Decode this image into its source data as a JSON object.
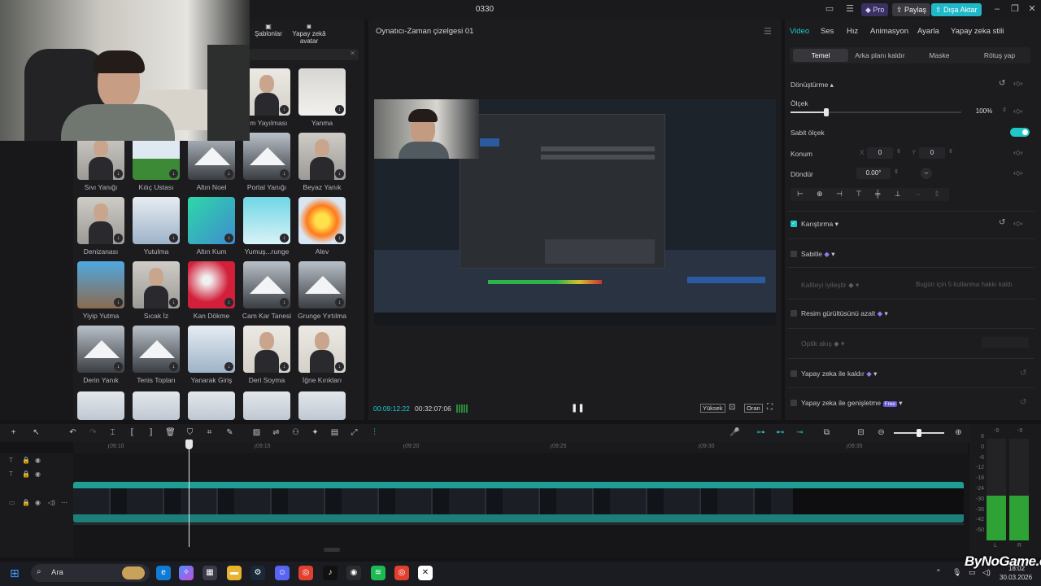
{
  "window": {
    "title": "0330",
    "pro_label": "Pro",
    "share_label": "Paylaş",
    "export_label": "Dışa Aktar"
  },
  "left_toolbar": {
    "templates_label": "Şablonlar",
    "ai_avatar_label": "Yapay zekâ avatar"
  },
  "effects": [
    {
      "label": "um Yayılması",
      "kind": "dark"
    },
    {
      "label": "Yanma",
      "kind": "light"
    },
    {
      "label": "Sıvı Yanığı",
      "kind": "face"
    },
    {
      "label": "Kılıç Ustası",
      "kind": "green"
    },
    {
      "label": "Altın Noel",
      "kind": "mountain"
    },
    {
      "label": "Portal Yanığı",
      "kind": "mountain"
    },
    {
      "label": "Beyaz Yanık",
      "kind": "face"
    },
    {
      "label": "Denizanası",
      "kind": "face"
    },
    {
      "label": "Yutulma",
      "kind": "sky"
    },
    {
      "label": "Altın Kum",
      "kind": "teal"
    },
    {
      "label": "Yumuş...runge",
      "kind": "cyan"
    },
    {
      "label": "Alev",
      "kind": "fire"
    },
    {
      "label": "Yiyip Yutma",
      "kind": "blue"
    },
    {
      "label": "Sıcak İz",
      "kind": "face"
    },
    {
      "label": "Kan Dökme",
      "kind": "red"
    },
    {
      "label": "Cam Kar Tanesi",
      "kind": "mountain"
    },
    {
      "label": "Grunge Yırtılma",
      "kind": "mountain"
    },
    {
      "label": "Derin Yanık",
      "kind": "mountain"
    },
    {
      "label": "Tenis Topları",
      "kind": "mountain"
    },
    {
      "label": "Yanarak Giriş",
      "kind": "sky"
    },
    {
      "label": "Deri Soyma",
      "kind": "dark"
    },
    {
      "label": "İğne Kırıkları",
      "kind": "dark"
    }
  ],
  "player": {
    "title": "Oynatıcı-Zaman çizelgesi 01",
    "current_time": "00:09:12:22",
    "total_time": "00:32:07:06",
    "quality_label": "Yüksek",
    "ratio_label": "Oran"
  },
  "inspector": {
    "tabs": [
      "Video",
      "Ses",
      "Hız",
      "Animasyon",
      "Ayarla",
      "Yapay zeka stili"
    ],
    "subtabs": [
      "Temel",
      "Arka planı kaldır",
      "Maske",
      "Rötuş yap"
    ],
    "transform_label": "Dönüştürme",
    "scale_label": "Ölçek",
    "scale_value": "100%",
    "scale_fraction": 0.1,
    "uniform_scale_label": "Sabit ölçek",
    "position_label": "Konum",
    "pos_x_label": "X",
    "pos_x": "0",
    "pos_y_label": "Y",
    "pos_y": "0",
    "rotate_label": "Döndür",
    "rotate_value": "0.00°",
    "blend_label": "Karıştırma",
    "stabilize_label": "Sabitle",
    "quality_label": "Kaliteyi iyileştir",
    "quality_hint": "Bugün için 5 kullanma hakkı kaldı",
    "denoise_label": "Resim gürültüsünü azalt",
    "optical_label": "Optik akış",
    "ai_remove_label": "Yapay zeka ile kaldır",
    "ai_expand_label": "Yapay zeka ile genişletme",
    "free_badge": "Free"
  },
  "timeline": {
    "ruler": [
      "09:10",
      "09:15",
      "09:20",
      "09:25",
      "09:30",
      "09:35"
    ]
  },
  "meter": {
    "top_l": "-9",
    "top_r": "-9",
    "scale": [
      "6",
      "0",
      "-6",
      "-12",
      "-18",
      "-24",
      "-30",
      "-36",
      "-42",
      "-50"
    ],
    "left_label": "L",
    "right_label": "R"
  },
  "taskbar": {
    "search_placeholder": "Ara",
    "date": "30.03.2026",
    "time": "18:02"
  },
  "watermark": "ByNoGame.com",
  "colors": {
    "accent": "#21c7c7",
    "bg": "#1c1c1f",
    "timeline_clip": "#1f9e96"
  }
}
